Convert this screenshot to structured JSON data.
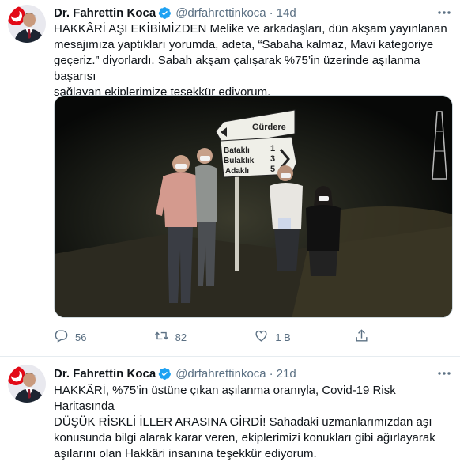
{
  "tweets": [
    {
      "author_name": "Dr. Fahrettin Koca",
      "handle": "@drfahrettinkoca",
      "separator": "·",
      "time": "14d",
      "text_lines": [
        "HAKKÂRİ AŞI EKİBİMİZDEN Melike ve arkadaşları, dün akşam yayınlanan",
        "mesajımıza yaptıkları yorumda, adeta, “Sabaha kalmaz, Mavi kategoriye",
        "geçeriz.” diyorlardı. Sabah akşam çalışarak %75’in üzerinde aşılanma başarısı",
        "sağlayan ekiplerimize teşekkür ediyorum."
      ],
      "photo_sign": {
        "top": "Gürdere",
        "rows": [
          {
            "place": "Bataklı",
            "km": "1"
          },
          {
            "place": "Bulaklık",
            "km": "3"
          },
          {
            "place": "Adaklı",
            "km": "5"
          }
        ]
      },
      "actions": {
        "reply_count": "56",
        "retweet_count": "82",
        "like_count": "1 B",
        "share_label": ""
      }
    },
    {
      "author_name": "Dr. Fahrettin Koca",
      "handle": "@drfahrettinkoca",
      "separator": "·",
      "time": "21d",
      "text_lines": [
        "HAKKÂRİ, %75’in üstüne çıkan aşılanma oranıyla, Covid-19 Risk Haritasında",
        "DÜŞÜK RİSKLİ İLLER ARASINA GİRDİ! Sahadaki uzmanlarımızdan aşı",
        "konusunda bilgi alarak karar veren, ekiplerimizi konukları gibi ağırlayarak",
        "aşılarını olan Hakkâri insanına teşekkür ediyorum."
      ]
    }
  ],
  "colors": {
    "verified": "#1da1f2",
    "secondary_text": "#5b7083",
    "divider": "#e6ecf0"
  },
  "icons": {
    "verified": "verified-badge-icon",
    "more": "more-icon",
    "reply": "reply-icon",
    "retweet": "retweet-icon",
    "like": "like-icon",
    "share": "share-icon"
  }
}
